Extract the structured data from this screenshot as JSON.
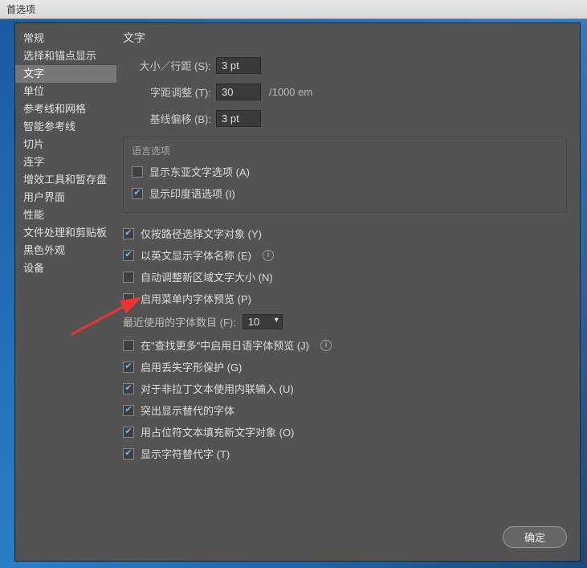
{
  "window_title": "首选项",
  "sidebar": {
    "items": [
      "常规",
      "选择和锚点显示",
      "文字",
      "单位",
      "参考线和网格",
      "智能参考线",
      "切片",
      "连字",
      "增效工具和暂存盘",
      "用户界面",
      "性能",
      "文件处理和剪贴板",
      "黑色外观",
      "设备"
    ],
    "active_index": 2
  },
  "main": {
    "title": "文字",
    "size_leading_label": "大小／行距 (S):",
    "size_leading_value": "3 pt",
    "tracking_label": "字距调整 (T):",
    "tracking_value": "30",
    "tracking_unit": "/1000 em",
    "baseline_label": "基线偏移 (B):",
    "baseline_value": "3 pt",
    "lang_group_title": "语言选项",
    "checkboxes": {
      "east_asian": {
        "label": "显示东亚文字选项 (A)",
        "checked": false
      },
      "indic": {
        "label": "显示印度语选项 (I)",
        "checked": true
      },
      "path_select": {
        "label": "仅按路径选择文字对象 (Y)",
        "checked": true
      },
      "english_fontname": {
        "label": "以英文显示字体名称 (E)",
        "checked": true
      },
      "auto_size_area": {
        "label": "自动调整新区域文字大小 (N)",
        "checked": false
      },
      "menu_preview": {
        "label": "启用菜单内字体预览 (P)",
        "checked": false
      },
      "jp_find_more": {
        "label": "在\"查找更多\"中启用日语字体预览 (J)",
        "checked": false
      },
      "missing_glyph": {
        "label": "启用丢失字形保护 (G)",
        "checked": true
      },
      "inline_input": {
        "label": "对于非拉丁文本使用内联输入 (U)",
        "checked": true
      },
      "highlight_sub": {
        "label": "突出显示替代的字体",
        "checked": true
      },
      "placeholder_fill": {
        "label": "用占位符文本填充新文字对象 (O)",
        "checked": true
      },
      "show_alternates": {
        "label": "显示字符替代字 (T)",
        "checked": true
      }
    },
    "recent_fonts_label": "最近使用的字体数目 (F):",
    "recent_fonts_value": "10"
  },
  "footer": {
    "ok_label": "确定"
  }
}
